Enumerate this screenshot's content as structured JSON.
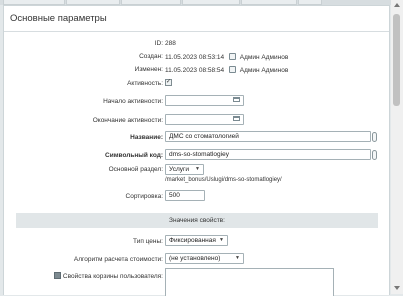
{
  "header": {
    "title": "Основные параметры"
  },
  "fields": {
    "id": {
      "label": "ID:",
      "value": "288"
    },
    "created": {
      "label": "Создан:",
      "value": "11.05.2023 08:53:14",
      "user": "Админ Админов"
    },
    "changed": {
      "label": "Изменен:",
      "value": "11.05.2023 08:58:54",
      "user": "Админ Админов"
    },
    "active": {
      "label": "Активность:",
      "checked": true
    },
    "active_from": {
      "label": "Начало активности:",
      "value": ""
    },
    "active_to": {
      "label": "Окончание активности:",
      "value": ""
    },
    "name": {
      "label": "Название:",
      "value": "ДМС со стоматологией"
    },
    "code": {
      "label": "Символьный код:",
      "value": "dms-so-stomatlogiey"
    },
    "section": {
      "label": "Основной раздел:",
      "value": "Услуги",
      "path": "/market_bonus/Uslugi/dms-so-stomatlogiey/"
    },
    "sort": {
      "label": "Сортировка:",
      "value": "500"
    }
  },
  "props": {
    "title": "Значения свойств:",
    "price_type": {
      "label": "Тип цены:",
      "value": "Фиксированная"
    },
    "algorithm": {
      "label": "Алгоритм расчета стоимости:",
      "value": "(не установлено)"
    },
    "basket": {
      "label": "Свойства корзины пользователя:"
    }
  },
  "icons": {
    "user": "user-icon",
    "calendar": "calendar-icon",
    "translit": "translit-icon",
    "check": "checkmark-icon"
  }
}
